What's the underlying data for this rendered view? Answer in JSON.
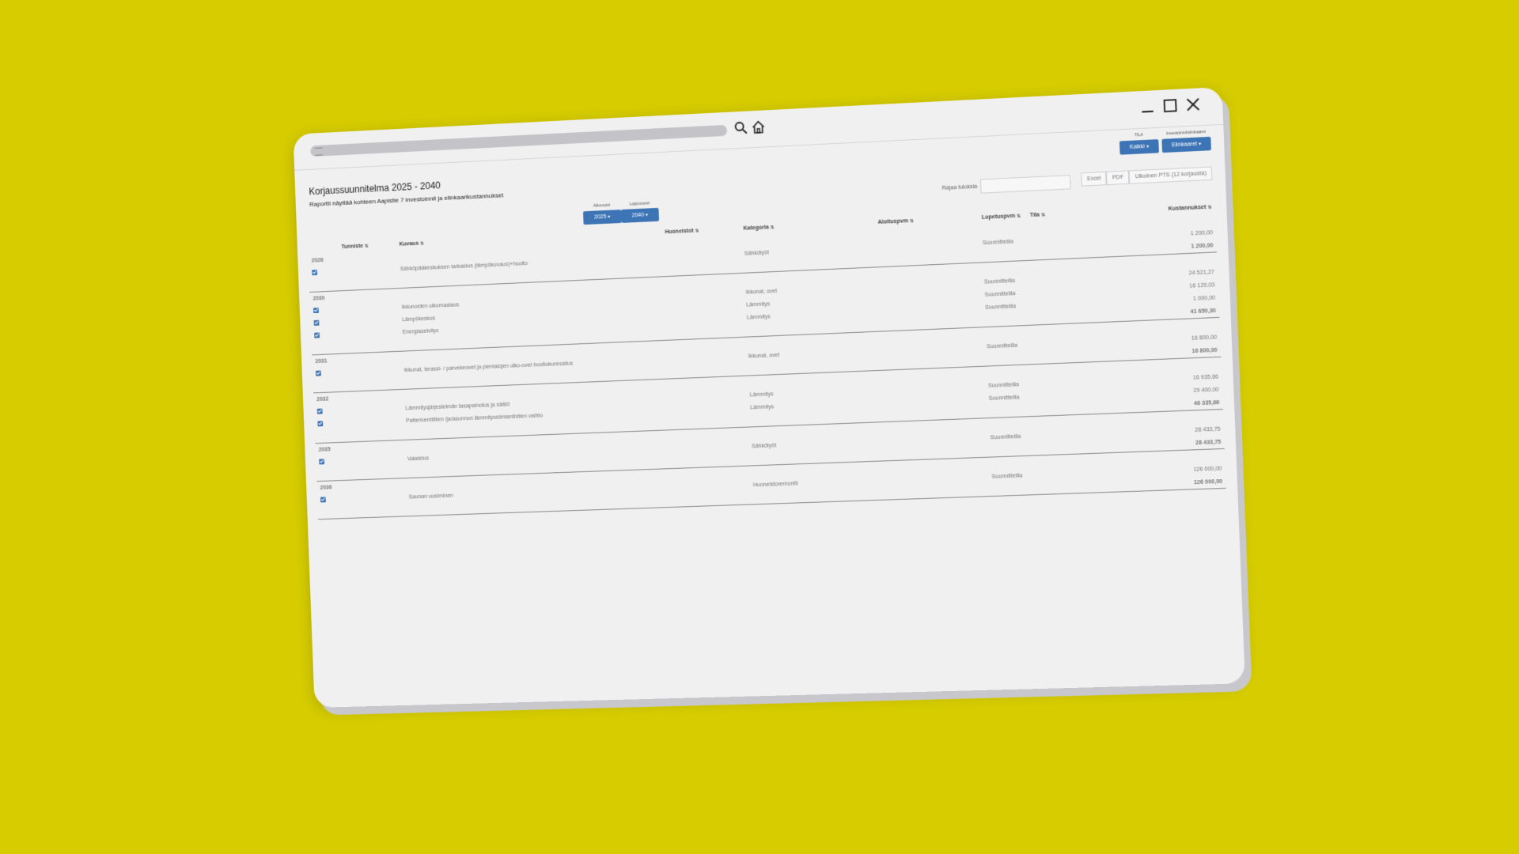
{
  "header": {
    "title": "Korjaussuunnitelma 2025 - 2040",
    "subtitle": "Raportti näyttää kohteen Aapistie 7 investoinnit ja elinkaarikustannukset"
  },
  "filters": {
    "tila_label": "TILA",
    "tila_value": "Kaikki",
    "inv_label": "Investoinnit/elinkaaret",
    "inv_value": "Elinkaaret",
    "start_label": "Alkuvuosi",
    "start_value": "2025",
    "end_label": "Loppuvuosi",
    "end_value": "2040"
  },
  "search": {
    "label": "Rajaa tuloksia",
    "placeholder": ""
  },
  "export": {
    "excel": "Excel",
    "pdf": "PDF",
    "pts": "Ulkoinen PTS (12 korjausta)"
  },
  "columns": {
    "tunniste": "Tunniste",
    "kuvaus": "Kuvaus",
    "huoneistot": "Huoneistot",
    "kategoria": "Kategoria",
    "aloitus": "Aloituspvm",
    "lopetus": "Lopetuspvm",
    "tila": "Tila",
    "kustannukset": "Kustannukset"
  },
  "groups": [
    {
      "year": "2026",
      "total": "1 200,00",
      "rows": [
        {
          "desc": "Sähköpääkeskuksen tarkastus (lämpökuvaus)+huolto",
          "cat": "Sähkötyöt",
          "status": "Suunnitteilla",
          "cost": "1 200,00"
        }
      ]
    },
    {
      "year": "2030",
      "total": "41 650,30",
      "rows": [
        {
          "desc": "Ikkunoiden ulkomaalaus",
          "cat": "Ikkunat, ovet",
          "status": "Suunnitteilla",
          "cost": "24 521,27"
        },
        {
          "desc": "Lämpökeskus",
          "cat": "Lämmitys",
          "status": "Suunnitteilla",
          "cost": "16 129,03"
        },
        {
          "desc": "Energiaselvitys",
          "cat": "Lämmitys",
          "status": "Suunnitteilla",
          "cost": "1 000,00"
        }
      ]
    },
    {
      "year": "2031",
      "total": "16 800,00",
      "rows": [
        {
          "desc": "Ikkunat, terassi- / parvekeovet ja pienialojen ulko-ovet huoltokunnostus",
          "cat": "Ikkunat, ovet",
          "status": "Suunnitteilla",
          "cost": "16 800,00"
        }
      ]
    },
    {
      "year": "2032",
      "total": "46 335,66",
      "rows": [
        {
          "desc": "Lämmitysjärjestelmän tasapainotus ja säätö",
          "cat": "Lämmitys",
          "status": "Suunnitteilla",
          "cost": "16 935,66"
        },
        {
          "desc": "Patteriventtiilien /ja/asunnon lämmityssiimiantintien vaihto",
          "cat": "Lämmitys",
          "status": "Suunnitteilla",
          "cost": "29 400,00"
        }
      ]
    },
    {
      "year": "2035",
      "total": "28 433,75",
      "rows": [
        {
          "desc": "Valaistus",
          "cat": "Sähkötyöt",
          "status": "Suunnitteilla",
          "cost": "28 433,75"
        }
      ]
    },
    {
      "year": "2036",
      "total": "126 000,00",
      "rows": [
        {
          "desc": "Saunan uusiminen",
          "cat": "Huoneistoremontti",
          "status": "Suunnitteilla",
          "cost": "126 000,00"
        }
      ]
    }
  ]
}
